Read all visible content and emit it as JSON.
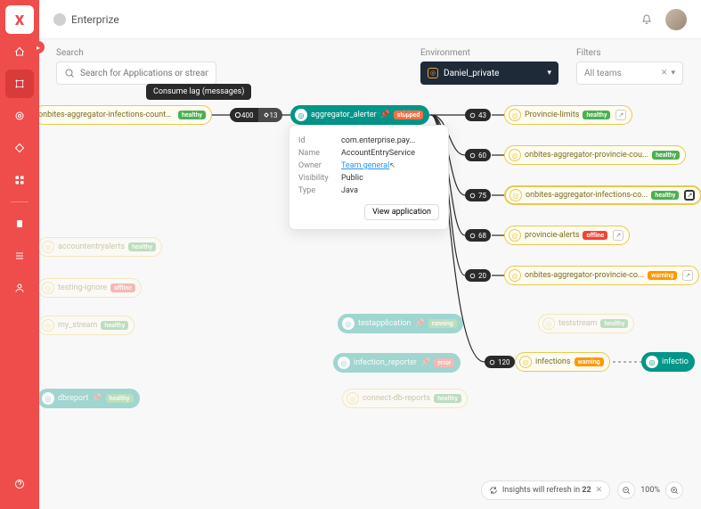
{
  "brand": "Enterprize",
  "search": {
    "label": "Search",
    "placeholder": "Search for Applications or streams"
  },
  "environment": {
    "label": "Environment",
    "value": "Daniel_private"
  },
  "filters": {
    "label": "Filters",
    "value": "All teams"
  },
  "tooltip": "Consume lag (messages)",
  "lag": {
    "a": "400",
    "b": "13"
  },
  "selected_node": {
    "name": "aggregator_alerter",
    "badge": "stopped"
  },
  "popover": {
    "id_label": "Id",
    "id": "com.enterprise.pay...",
    "name_label": "Name",
    "name": "AccountEntryService",
    "owner_label": "Owner",
    "owner": "Team general",
    "visibility_label": "Visibility",
    "visibility": "Public",
    "type_label": "Type",
    "type": "Java",
    "button": "View application"
  },
  "upstream": {
    "name": "onbites-aggregator-infections-counts-repartition",
    "badge": "healthy"
  },
  "downstream": [
    {
      "count": "43",
      "name": "Provincie-limits",
      "badge": "healthy",
      "tag": true
    },
    {
      "count": "60",
      "name": "onbites-aggregator-provincie-cou...",
      "badge": "healthy"
    },
    {
      "count": "75",
      "name": "onbites-aggregator-infections-co...",
      "badge": "healthy",
      "tag": true,
      "bold": true
    },
    {
      "count": "68",
      "name": "provincie-alerts",
      "badge": "offline",
      "tag": true
    },
    {
      "count": "20",
      "name": "onbites-aggregator-provincie-co...",
      "badge": "warning",
      "tag": true
    },
    {
      "count": "120",
      "name": "infections",
      "badge": "warning"
    }
  ],
  "faded_left": [
    {
      "name": "accountentryalerts",
      "badge": "healthy"
    },
    {
      "name": "testing-ignore",
      "badge": "offline"
    },
    {
      "name": "my_stream",
      "badge": "healthy"
    },
    {
      "name": "dbreport",
      "badge": "healthy"
    }
  ],
  "faded_mid": [
    {
      "name": "testapplication",
      "badge": "running"
    },
    {
      "name": "infection_reporter",
      "badge": "error"
    },
    {
      "name": "connect-db-reports",
      "badge": "healthy"
    }
  ],
  "faded_right": [
    {
      "name": "teststream",
      "badge": "healthy"
    },
    {
      "name": "infectio"
    }
  ],
  "status": {
    "text_a": "Insights will refresh in ",
    "count": "22",
    "zoom": "100%"
  }
}
